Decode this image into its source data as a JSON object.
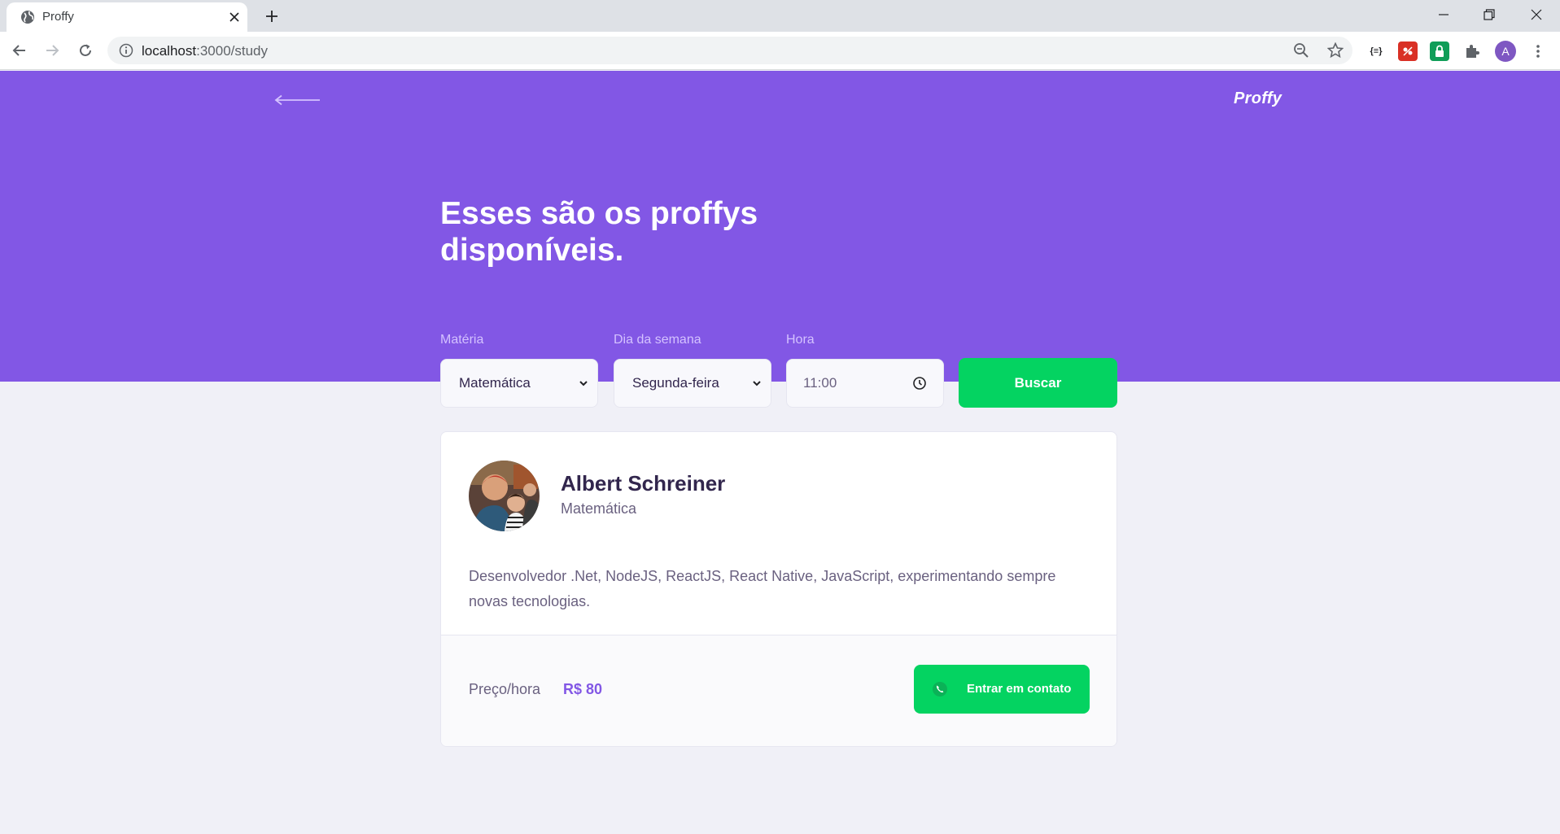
{
  "browser": {
    "tab_title": "Proffy",
    "url_host": "localhost",
    "url_rest": ":3000/study",
    "profile_initial": "A",
    "extension_json_label": "{≡}"
  },
  "header": {
    "brand": "Proffy",
    "headline": "Esses são os proffys disponíveis."
  },
  "filters": {
    "subject_label": "Matéria",
    "subject_value": "Matemática",
    "weekday_label": "Dia da semana",
    "weekday_value": "Segunda-feira",
    "time_label": "Hora",
    "time_value": "11:00",
    "search_label": "Buscar"
  },
  "teacher": {
    "name": "Albert Schreiner",
    "subject": "Matemática",
    "bio": "Desenvolvedor .Net, NodeJS, ReactJS, React Native, JavaScript, experimentando sempre novas tecnologias.",
    "price_label": "Preço/hora",
    "price_value": "R$ 80",
    "contact_label": "Entrar em contato"
  },
  "colors": {
    "primary": "#8257E5",
    "secondary": "#04D361",
    "background": "#F0F0F7",
    "title": "#32264D",
    "text": "#6A6180"
  }
}
